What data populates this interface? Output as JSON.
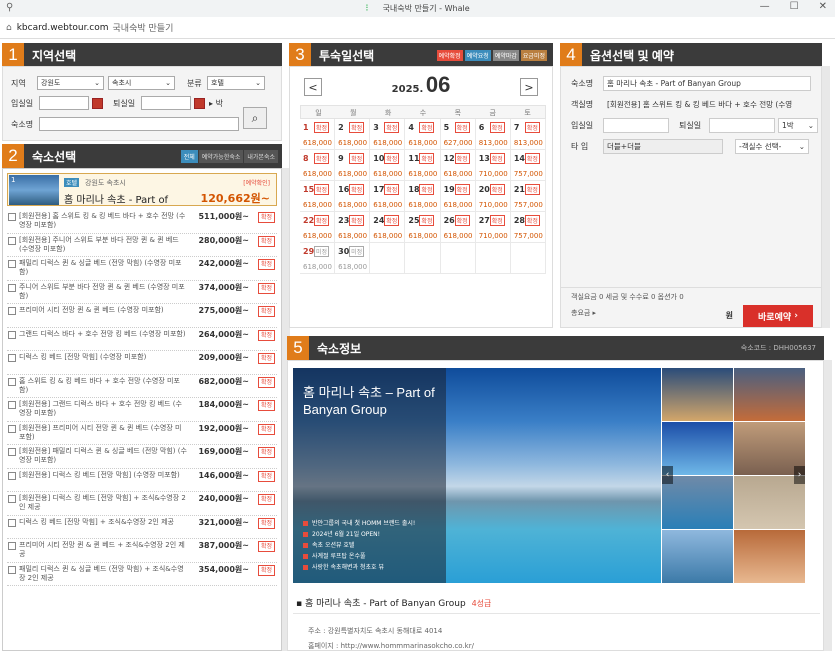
{
  "window": {
    "title": "국내숙박 만들기 - Whale"
  },
  "address": {
    "host": "kbcard.webtour.com",
    "page_title": "국내숙박 만들기"
  },
  "panel1": {
    "num": "1",
    "title": "지역선택",
    "label_region": "지역",
    "region": "강원도",
    "city": "속초시",
    "label_category": "분류",
    "category": "호텔",
    "label_checkin": "입실일",
    "label_checkout": "퇴실일",
    "nights_suffix": "박",
    "label_name": "숙소명"
  },
  "panel2": {
    "num": "2",
    "title": "숙소선택",
    "tabs": [
      "전체",
      "예약가능한숙소",
      "내가본숙소"
    ],
    "hotel": {
      "idx": "1",
      "badge": "호텔",
      "region": "강원도 속초시",
      "status": "[예약확인]",
      "name": "홈 마리나 속초 - Part of",
      "price": "120,662원~"
    },
    "btn_label": "확정",
    "rooms": [
      {
        "name": "[회원전용] 홈 스위트 킹 & 킹 베드 바다 + 호수 전망 (수영장 미포함)",
        "price": "511,000원~"
      },
      {
        "name": "[회원전용] 주니어 스위트 부분 바다 전망 퀸 & 퀸 베드 (수영장 미포함)",
        "price": "280,000원~"
      },
      {
        "name": "패밀리 디럭스 퀸 & 싱글 베드 (전망 막힘) (수영장 미포함)",
        "price": "242,000원~"
      },
      {
        "name": "주니어 스위트 부분 바다 전망 퀸 & 퀸 베드 (수영장 미포함)",
        "price": "374,000원~"
      },
      {
        "name": "프리미어 시티 전망 퀸 & 퀸 베드 (수영장 미포함)",
        "price": "275,000원~"
      },
      {
        "name": "그랜드 디럭스 바다 + 호수 전망 킹 베드 (수영장 미포함)",
        "price": "264,000원~"
      },
      {
        "name": "디럭스 킹 베드 [전망 막힘] (수영장 미포함)",
        "price": "209,000원~"
      },
      {
        "name": "홈 스위트 킹 & 킹 베드 바다 + 호수 전망 (수영장 미포함)",
        "price": "682,000원~"
      },
      {
        "name": "[회원전용] 그랜드 디럭스 바다 + 호수 전망 킹 베드 (수영장 미포함)",
        "price": "184,000원~"
      },
      {
        "name": "[회원전용] 프리미어 시티 전망 퀸 & 퀸 베드 (수영장 미포함)",
        "price": "192,000원~"
      },
      {
        "name": "[회원전용] 패밀리 디럭스 퀸 & 싱글 베드 (전망 막힘) (수영장 미포함)",
        "price": "169,000원~"
      },
      {
        "name": "[회원전용] 디럭스 킹 베드 [전망 막힘] (수영장 미포함)",
        "price": "146,000원~"
      },
      {
        "name": "[회원전용] 디럭스 킹 베드 [전망 막힘] + 조식&수영장 2인 제공",
        "price": "240,000원~"
      },
      {
        "name": "디럭스 킹 베드 [전망 막힘] + 조식&수영장 2인 제공",
        "price": "321,000원~"
      },
      {
        "name": "프리미어 시티 전망 퀸 & 퀸 베드 + 조식&수영장 2인 제공",
        "price": "387,000원~"
      },
      {
        "name": "패밀리 디럭스 퀸 & 싱글 베드 (전망 막힘) + 조식&수영장 2인 제공",
        "price": "354,000원~"
      }
    ]
  },
  "panel3": {
    "num": "3",
    "title": "투숙일선택",
    "legend": [
      "예약확정",
      "예약요청",
      "예약마감",
      "요금미정"
    ],
    "year": "2025.",
    "month": "06",
    "dows": [
      "일",
      "월",
      "화",
      "수",
      "목",
      "금",
      "토"
    ],
    "weeks": [
      [
        {
          "d": "1",
          "t": "확정",
          "p": "618,000",
          "r": true
        },
        {
          "d": "2",
          "t": "확정",
          "p": "618,000"
        },
        {
          "d": "3",
          "t": "확정",
          "p": "618,000"
        },
        {
          "d": "4",
          "t": "확정",
          "p": "618,000"
        },
        {
          "d": "5",
          "t": "확정",
          "p": "627,000"
        },
        {
          "d": "6",
          "t": "확정",
          "p": "813,000"
        },
        {
          "d": "7",
          "t": "확정",
          "p": "813,000"
        }
      ],
      [
        {
          "d": "8",
          "t": "확정",
          "p": "618,000",
          "r": true
        },
        {
          "d": "9",
          "t": "확정",
          "p": "618,000"
        },
        {
          "d": "10",
          "t": "확정",
          "p": "618,000"
        },
        {
          "d": "11",
          "t": "확정",
          "p": "618,000"
        },
        {
          "d": "12",
          "t": "확정",
          "p": "618,000"
        },
        {
          "d": "13",
          "t": "확정",
          "p": "710,000"
        },
        {
          "d": "14",
          "t": "확정",
          "p": "757,000"
        }
      ],
      [
        {
          "d": "15",
          "t": "확정",
          "p": "618,000",
          "r": true
        },
        {
          "d": "16",
          "t": "확정",
          "p": "618,000"
        },
        {
          "d": "17",
          "t": "확정",
          "p": "618,000"
        },
        {
          "d": "18",
          "t": "확정",
          "p": "618,000"
        },
        {
          "d": "19",
          "t": "확정",
          "p": "618,000"
        },
        {
          "d": "20",
          "t": "확정",
          "p": "710,000"
        },
        {
          "d": "21",
          "t": "확정",
          "p": "757,000"
        }
      ],
      [
        {
          "d": "22",
          "t": "확정",
          "p": "618,000",
          "r": true
        },
        {
          "d": "23",
          "t": "확정",
          "p": "618,000"
        },
        {
          "d": "24",
          "t": "확정",
          "p": "618,000"
        },
        {
          "d": "25",
          "t": "확정",
          "p": "618,000"
        },
        {
          "d": "26",
          "t": "확정",
          "p": "618,000"
        },
        {
          "d": "27",
          "t": "확정",
          "p": "710,000"
        },
        {
          "d": "28",
          "t": "확정",
          "p": "757,000"
        }
      ],
      [
        {
          "d": "29",
          "t": "미정",
          "p": "618,000",
          "r": true,
          "g": true
        },
        {
          "d": "30",
          "t": "미정",
          "p": "618,000",
          "g": true
        },
        {},
        {},
        {},
        {},
        {}
      ]
    ]
  },
  "panel4": {
    "num": "4",
    "title": "옵션선택 및 예약",
    "label_hotel": "숙소명",
    "hotel": "홈 마리나 속초 - Part of Banyan Group",
    "label_room": "객실명",
    "room": "[회원전용] 홈 스위트 킹 & 킹 베드 바다 + 호수 전망 (수영",
    "label_checkin": "입실일",
    "label_checkout": "퇴실일",
    "nights": "1박",
    "label_type": "타  입",
    "type": "더블+더블",
    "count_select": "-객실수 선택-",
    "totals_line": "객실요금 0   세금 및 수수료 0   옵션가 0",
    "total_label": "총요금",
    "won": "원",
    "book_label": "바로예약"
  },
  "panel5": {
    "num": "5",
    "title": "숙소정보",
    "code": "숙소코드 : DHH005637",
    "img_title": "홈 마리나 속초 – Part of Banyan Group",
    "bullets": [
      "반얀그룹의 국내 첫 HOMM 브랜드 출시!",
      "2024년 6월 21일 OPEN!",
      "속초 오션뷰 호텔",
      "사계절 루프탑 온수풀",
      "사랑한 속초해변과 청초호 뷰"
    ],
    "name": "홈 마리나 속초 - Part of Banyan Group",
    "grade": "4성급",
    "address": "주소 : 강원특별자치도 속초시 동해대로 4014",
    "homepage": "홈페이지 : http://www.hommmarinasokcho.co.kr/"
  },
  "colors": {
    "accent_orange": "#e07c1a",
    "header_dark": "#3b3b3b",
    "book_red": "#d9302a",
    "confirm_red": "#e74c3c",
    "price_orange": "#d35400"
  }
}
